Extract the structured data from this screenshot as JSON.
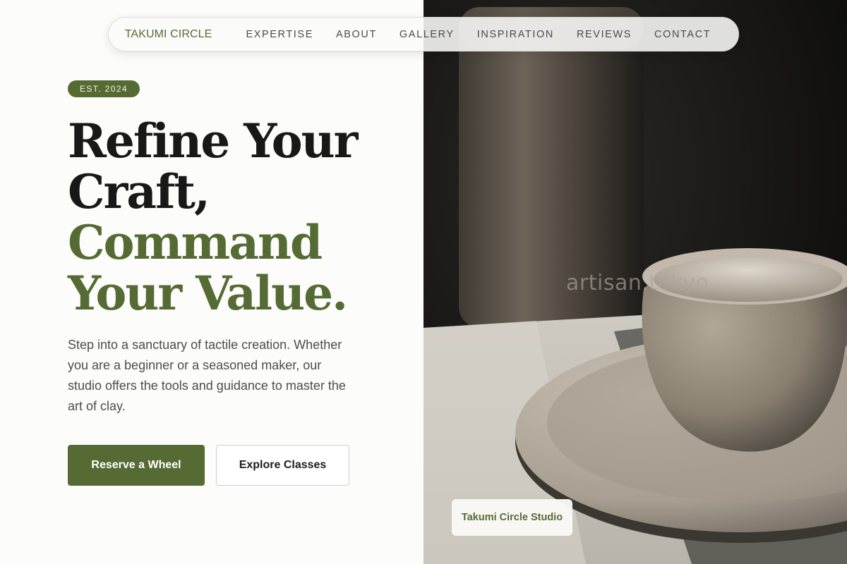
{
  "nav": {
    "brand": "TAKUMI CIRCLE",
    "links": [
      "EXPERTISE",
      "ABOUT",
      "GALLERY",
      "INSPIRATION",
      "REVIEWS",
      "CONTACT"
    ]
  },
  "hero": {
    "badge": "EST. 2024",
    "headline_line1": "Refine Your",
    "headline_line2": "Craft,",
    "headline_line3": "Command",
    "headline_line4": "Your Value.",
    "description": "Step into a sanctuary of tactile creation. Whether you are a beginner or a seasoned maker, our studio offers the tools and guidance to master the art of clay.",
    "primary_button": "Reserve a Wheel",
    "secondary_button": "Explore Classes"
  },
  "image": {
    "watermark": "artisan.tokyo",
    "studio_label": "Takumi Circle Studio"
  },
  "colors": {
    "accent": "#566b34",
    "text_dark": "#181818",
    "background": "#fcfcfb"
  }
}
